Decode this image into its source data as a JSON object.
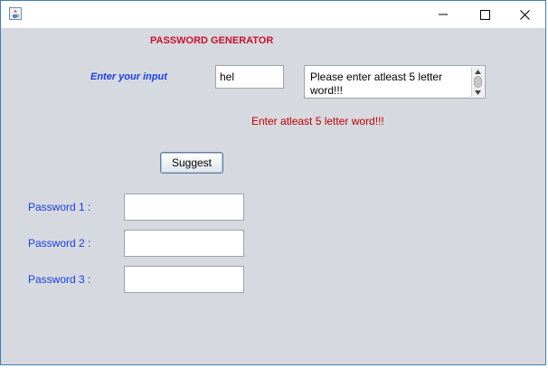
{
  "window": {
    "icon": "java-cup-icon",
    "controls": {
      "minimize": "minimize-icon",
      "maximize": "maximize-icon",
      "close": "close-icon"
    }
  },
  "form": {
    "heading": "PASSWORD GENERATOR",
    "input_label": "Enter your input",
    "input_value": "hel",
    "message_box_text": "Please enter atleast 5 letter word!!!",
    "error_message": "Enter atleast 5 letter word!!!",
    "suggest_button": "Suggest",
    "passwords": [
      {
        "label": "Password 1 :",
        "value": ""
      },
      {
        "label": "Password 2 :",
        "value": ""
      },
      {
        "label": "Password 3 :",
        "value": ""
      }
    ]
  },
  "colors": {
    "heading": "#c8102e",
    "labels": "#1a3ee0",
    "error": "#c00000",
    "background": "#d6d9df"
  }
}
